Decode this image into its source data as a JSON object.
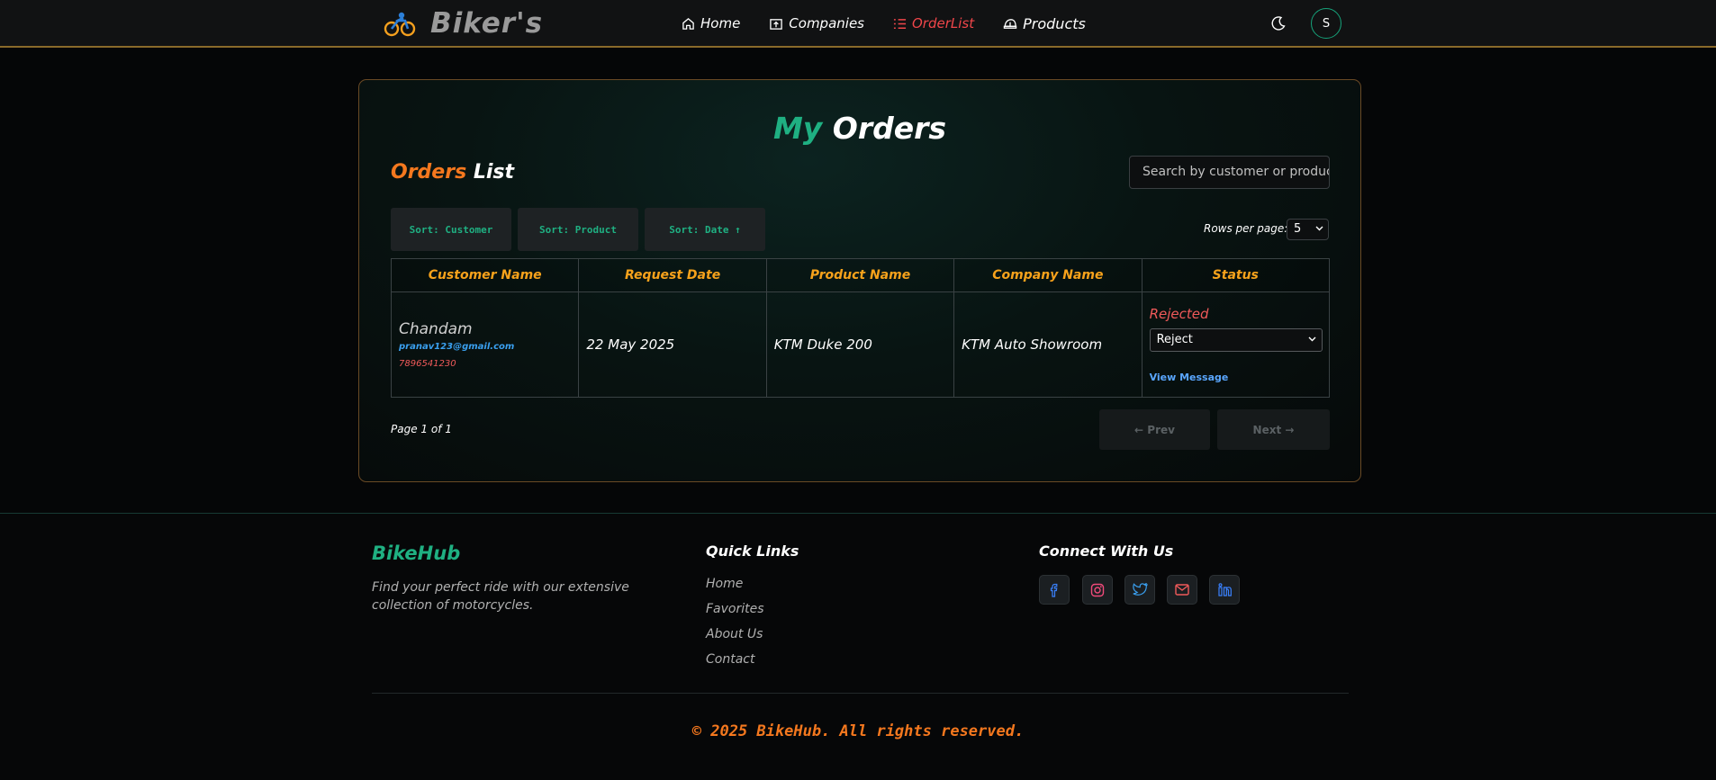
{
  "nav": {
    "brand": "Biker's",
    "links": [
      "Home",
      "Companies",
      "OrderList",
      "Products"
    ],
    "avatar_initial": "S"
  },
  "main": {
    "title_accent": "My",
    "title_rest": "Orders",
    "list_title_accent": "Orders",
    "list_title_rest": "List",
    "search_placeholder": "Search by customer or product",
    "sort_buttons": [
      "Sort: Customer",
      "Sort: Product",
      "Sort: Date ↑"
    ],
    "rows_label": "Rows per page:",
    "rows_value": "5",
    "columns": [
      "Customer Name",
      "Request Date",
      "Product Name",
      "Company Name",
      "Status"
    ],
    "rows": [
      {
        "customer": "Chandam",
        "email": "pranav123@gmail.com",
        "phone": "7896541230",
        "date": "22 May 2025",
        "product": "KTM Duke 200",
        "company": "KTM Auto Showroom",
        "status": "Rejected",
        "status_select": "Reject",
        "view_message": "View Message"
      }
    ],
    "page_info": "Page 1 of 1",
    "prev_label": "← Prev",
    "next_label": "Next →"
  },
  "footer": {
    "brand": "BikeHub",
    "description": "Find your perfect ride with our extensive collection of motorcycles.",
    "quick_links_heading": "Quick Links",
    "quick_links": [
      "Home",
      "Favorites",
      "About Us",
      "Contact"
    ],
    "connect_heading": "Connect With Us",
    "socials": [
      "facebook-icon",
      "instagram-icon",
      "twitter-icon",
      "mail-icon",
      "linkedin-icon"
    ],
    "copyright": "© 2025 BikeHub. All rights reserved."
  },
  "colors": {
    "accent_green": "#1fb082",
    "accent_orange": "#f5781e",
    "header_gold": "#f7a21b",
    "active_red": "#f0464a"
  }
}
